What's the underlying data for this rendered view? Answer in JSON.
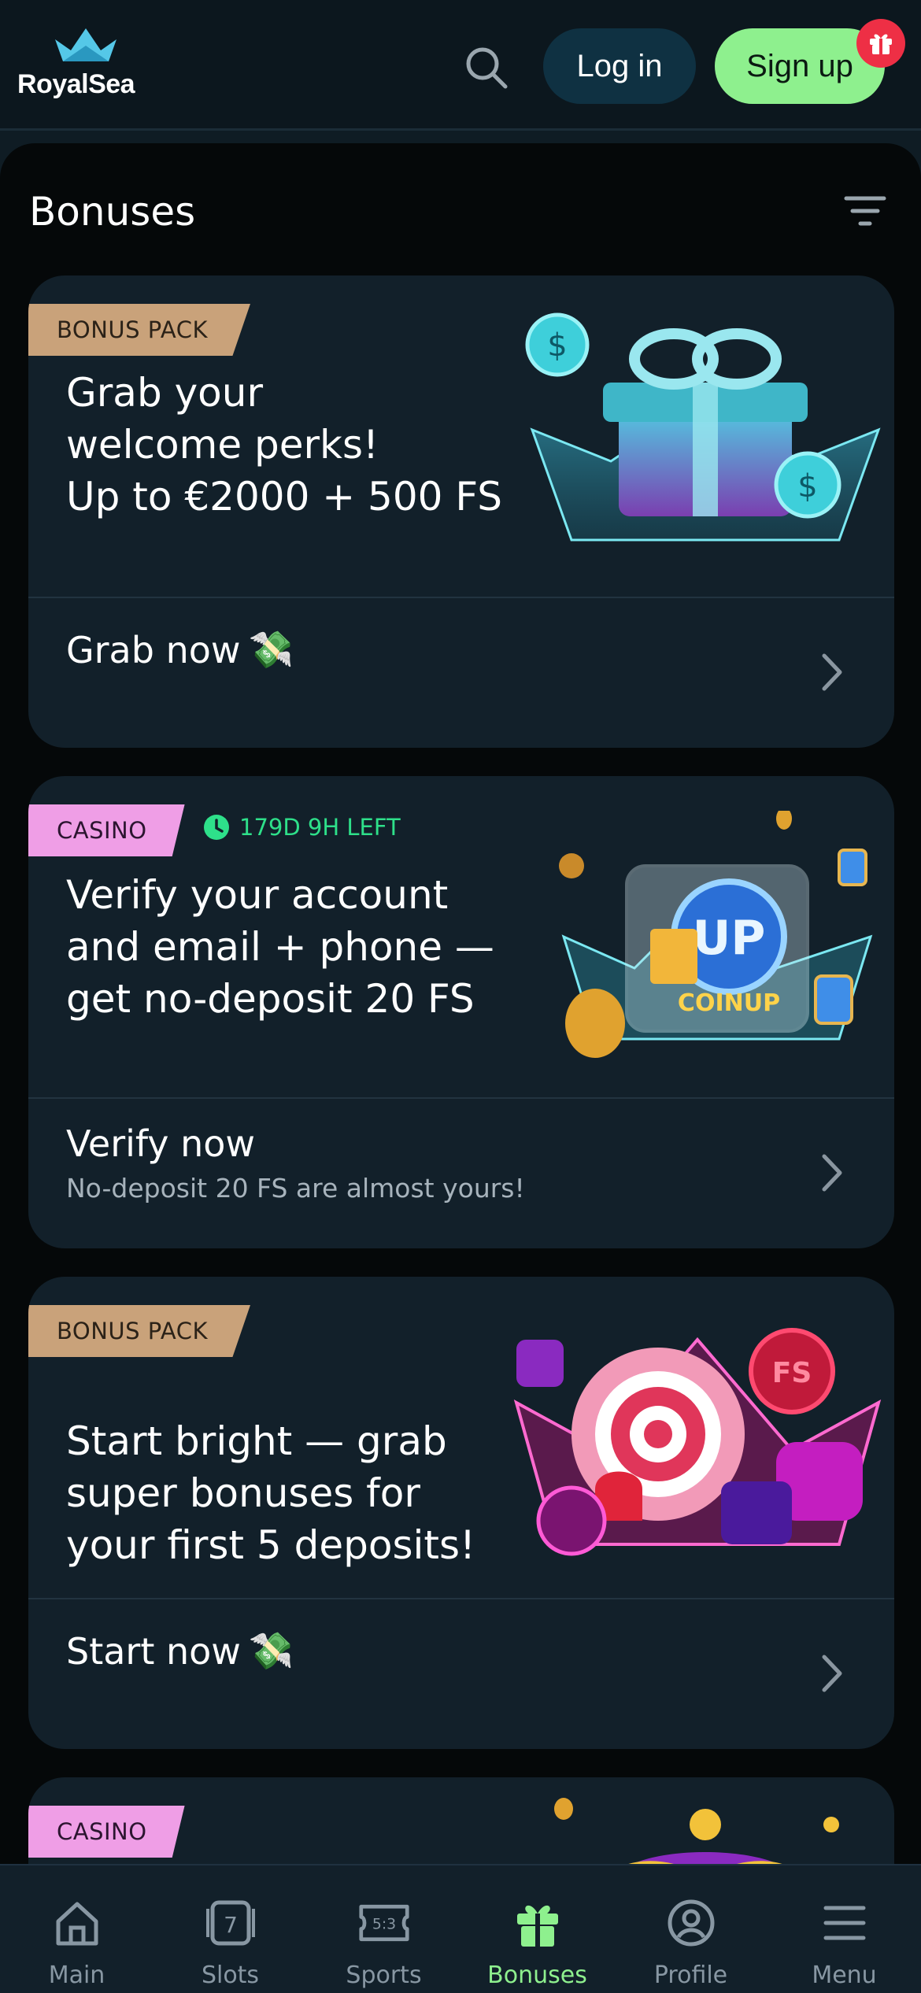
{
  "header": {
    "logo_text": "RoyalSea",
    "login_label": "Log in",
    "signup_label": "Sign up"
  },
  "page": {
    "title": "Bonuses"
  },
  "cards": [
    {
      "tag": "BONUS PACK",
      "title_lines": [
        "Grab your",
        "welcome perks!",
        "Up to €2000 + 500 FS"
      ],
      "action": "Grab now",
      "action_emoji": "💸"
    },
    {
      "tag": "CASINO",
      "timer": "179D 9H LEFT",
      "title_lines": [
        "Verify your account",
        "and email + phone —",
        "get no-deposit 20 FS"
      ],
      "action": "Verify now",
      "subtext": "No-deposit 20 FS are almost yours!"
    },
    {
      "tag": "BONUS PACK",
      "title_lines": [
        "Start bright — grab",
        "super bonuses for",
        "your first 5 deposits!"
      ],
      "action": "Start now",
      "action_emoji": "💸"
    },
    {
      "tag": "CASINO"
    }
  ],
  "bottom_nav": [
    {
      "label": "Main",
      "icon": "home-icon"
    },
    {
      "label": "Slots",
      "icon": "slots-icon"
    },
    {
      "label": "Sports",
      "icon": "sports-icon"
    },
    {
      "label": "Bonuses",
      "icon": "gift-icon",
      "active": true
    },
    {
      "label": "Profile",
      "icon": "profile-icon"
    },
    {
      "label": "Menu",
      "icon": "menu-icon"
    }
  ],
  "colors": {
    "accent_green": "#8ef08e",
    "bonus_tag": "#c9a27a",
    "casino_tag": "#ef9ee6",
    "timer_green": "#2ee08a",
    "badge_red": "#ee2f45"
  }
}
